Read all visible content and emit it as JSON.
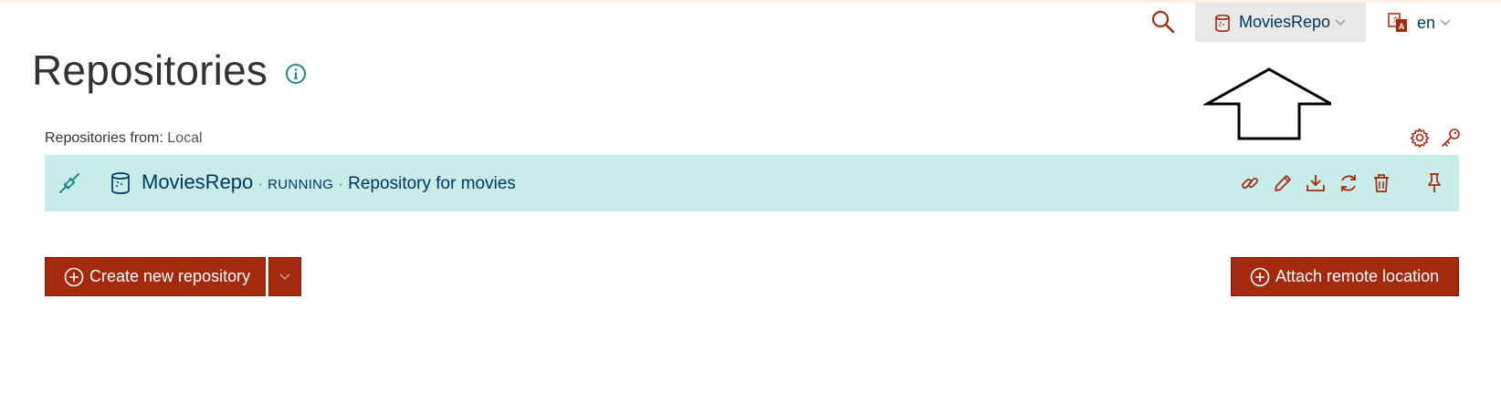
{
  "header": {
    "search_icon": "search-icon",
    "repository_selector": {
      "label": "MoviesRepo",
      "icon": "database-icon"
    },
    "language_selector": {
      "label": "en",
      "icon": "translate-icon"
    }
  },
  "page": {
    "title": "Repositories",
    "info_icon": "info-icon"
  },
  "repositories_from": {
    "label": "Repositories from:",
    "value": "Local"
  },
  "repository": {
    "name": "MoviesRepo",
    "separator": "·",
    "status": "RUNNING",
    "description": "Repository for movies"
  },
  "buttons": {
    "create": "Create new repository",
    "attach": "Attach remote location"
  },
  "colors": {
    "accent": "#a3290f",
    "row_background": "#c8ece8",
    "text_primary": "#003663",
    "teal_icon": "#1f8a80"
  }
}
